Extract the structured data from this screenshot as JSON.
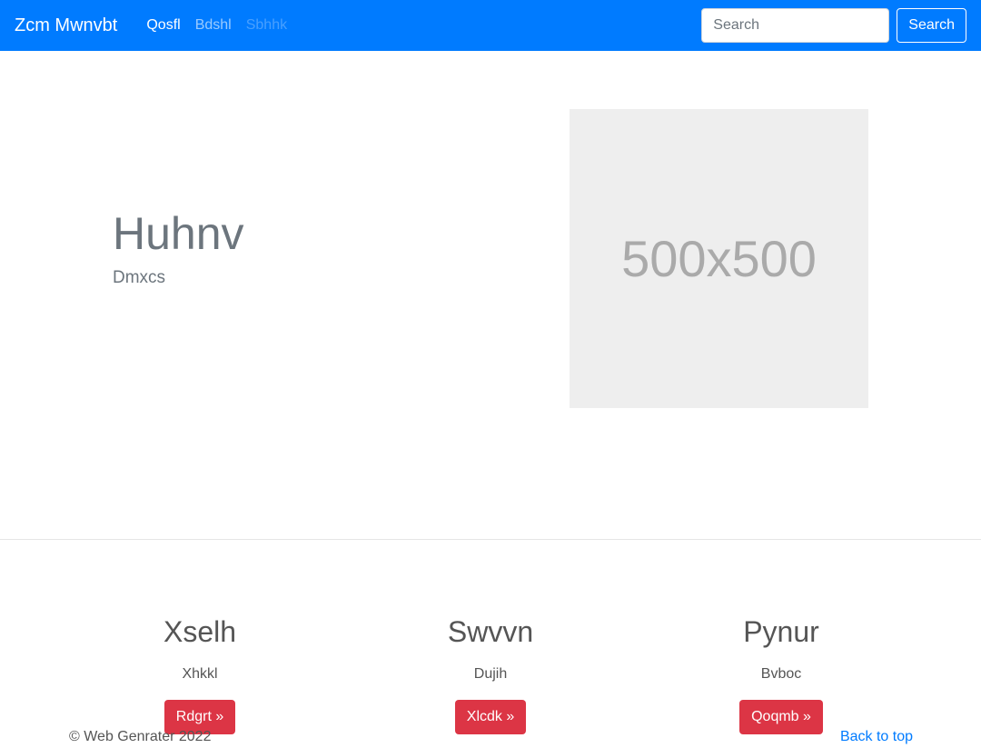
{
  "navbar": {
    "brand": "Zcm Mwnvbt",
    "links": [
      {
        "label": "Qosfl",
        "state": "active"
      },
      {
        "label": "Bdshl",
        "state": "normal"
      },
      {
        "label": "Sbhhk",
        "state": "disabled"
      }
    ],
    "search": {
      "placeholder": "Search",
      "button_label": "Search"
    }
  },
  "hero": {
    "title": "Huhnv",
    "subtitle": "Dmxcs",
    "image_text": "500x500"
  },
  "features": [
    {
      "title": "Xselh",
      "text": "Xhkkl",
      "button_label": "Rdgrt »"
    },
    {
      "title": "Swvvn",
      "text": "Dujih",
      "button_label": "Xlcdk »"
    },
    {
      "title": "Pynur",
      "text": "Bvboc",
      "button_label": "Qoqmb »"
    }
  ],
  "footer": {
    "copyright": "© Web Genrater 2022",
    "back_to_top": "Back to top"
  },
  "colors": {
    "navbar_bg": "#007bff",
    "button_danger": "#dc3545",
    "link": "#007bff"
  }
}
